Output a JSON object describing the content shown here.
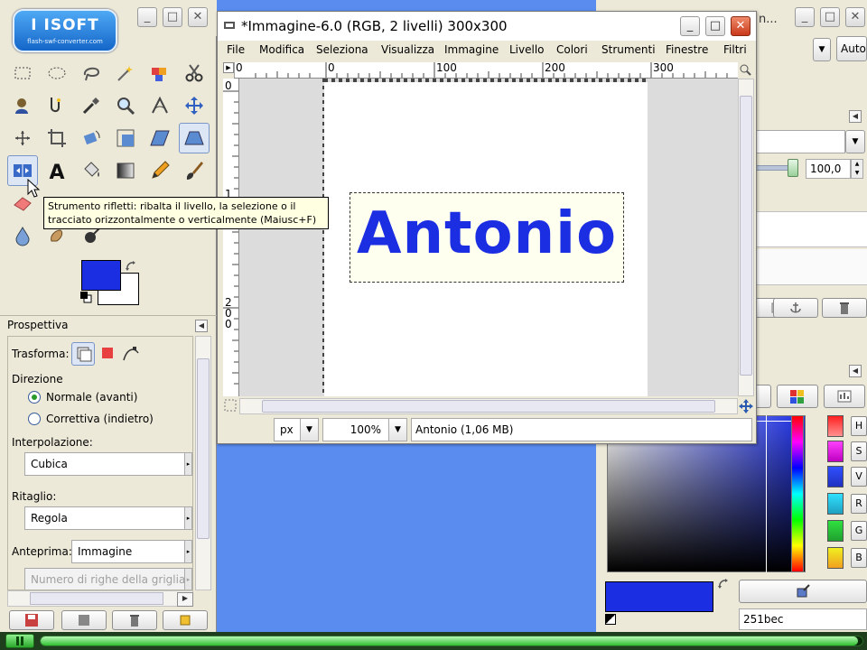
{
  "logo": {
    "main": "I ISOFT",
    "sub": "flash-swf-converter.com"
  },
  "image_window": {
    "title": "*Immagine-6.0 (RGB, 2 livelli) 300x300",
    "menu": [
      "File",
      "Modifica",
      "Seleziona",
      "Visualizza",
      "Immagine",
      "Livello",
      "Colori",
      "Strumenti",
      "Finestre",
      "Filtri"
    ],
    "ruler_h_labels": [
      "0",
      "0",
      "100",
      "200",
      "300"
    ],
    "ruler_v_labels": [
      "0",
      "1",
      "2",
      "0",
      "0"
    ],
    "canvas_text": "Antonio",
    "unit": "px",
    "zoom": "100%",
    "status": "Antonio (1,06 MB)"
  },
  "tooltip": {
    "line1": "Strumento rifletti: ribalta il livello, la selezione o il",
    "line2": "tracciato orizzontalmente o verticalmente  (Maiusc+F)"
  },
  "tool_options": {
    "title": "Prospettiva",
    "transform_label": "Trasforma:",
    "direction_label": "Direzione",
    "direction_normal": "Normale (avanti)",
    "direction_corrective": "Correttiva (indietro)",
    "interpolation_label": "Interpolazione:",
    "interpolation_value": "Cubica",
    "clipping_label": "Ritaglio:",
    "clipping_value": "Regola",
    "preview_label": "Anteprima:",
    "preview_value": "Immagine",
    "grid_placeholder": "Numero di righe della griglia"
  },
  "dock": {
    "title_fragment": "n...",
    "auto_label": "Auto",
    "opacity_value": "100,0",
    "hex_value": "251bec",
    "channels": [
      "H",
      "S",
      "V",
      "R",
      "G",
      "B"
    ]
  },
  "colors": {
    "foreground": "#1c2ee2",
    "background": "#ffffff"
  },
  "playback": {
    "progress_fraction": 0.995
  }
}
